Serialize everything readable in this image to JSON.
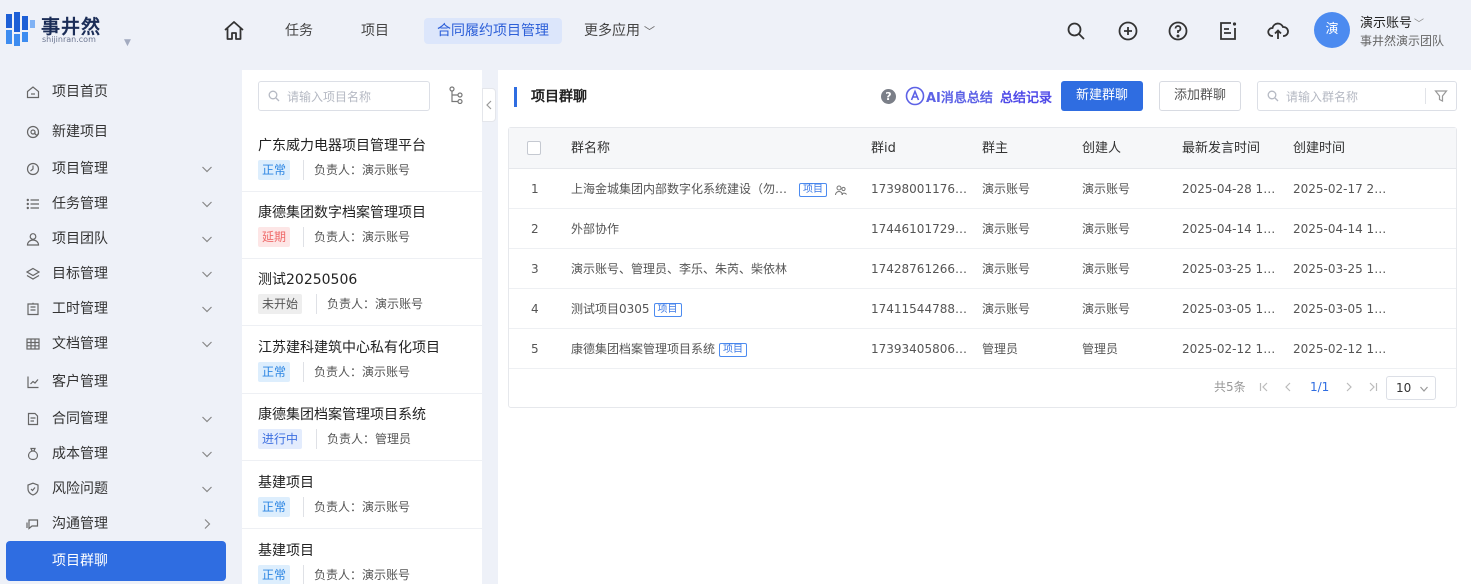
{
  "brand": {
    "name_cn": "事井然",
    "name_en": "shijinran.com"
  },
  "nav": {
    "items": [
      {
        "label": "任务"
      },
      {
        "label": "项目"
      },
      {
        "label": "合同履约项目管理",
        "active": true
      },
      {
        "label": "更多应用"
      }
    ]
  },
  "user": {
    "name": "演示账号",
    "avatar_text": "演",
    "team": "事井然演示团队",
    "caret": "﹀"
  },
  "sidebar": {
    "items": [
      {
        "label": "项目首页",
        "icon": "home-outline-icon",
        "expandable": false
      },
      {
        "label": "新建项目",
        "icon": "at-icon",
        "expandable": false
      },
      {
        "label": "项目管理",
        "icon": "clock-icon",
        "expandable": true
      },
      {
        "label": "任务管理",
        "icon": "list-icon",
        "expandable": true
      },
      {
        "label": "项目团队",
        "icon": "user-icon",
        "expandable": true
      },
      {
        "label": "目标管理",
        "icon": "layers-icon",
        "expandable": true
      },
      {
        "label": "工时管理",
        "icon": "timesheet-icon",
        "expandable": true
      },
      {
        "label": "文档管理",
        "icon": "table-icon",
        "expandable": true
      },
      {
        "label": "客户管理",
        "icon": "customer-icon",
        "expandable": false
      },
      {
        "label": "合同管理",
        "icon": "contract-icon",
        "expandable": true
      },
      {
        "label": "成本管理",
        "icon": "money-bag-icon",
        "expandable": true
      },
      {
        "label": "风险问题",
        "icon": "shield-icon",
        "expandable": true
      },
      {
        "label": "沟通管理",
        "icon": "chat-icon",
        "expandable": true,
        "chevron": "right"
      },
      {
        "label": "项目群聊",
        "active": true
      }
    ]
  },
  "project_list": {
    "search_placeholder": "请输入项目名称",
    "items": [
      {
        "title": "广东威力电器项目管理平台",
        "status": "正常",
        "status_type": "normal",
        "owner": "负责人：演示账号"
      },
      {
        "title": "康德集团数字档案管理项目",
        "status": "延期",
        "status_type": "delay",
        "owner": "负责人：演示账号"
      },
      {
        "title": "测试20250506",
        "status": "未开始",
        "status_type": "notstart",
        "owner": "负责人：演示账号"
      },
      {
        "title": "江苏建科建筑中心私有化项目",
        "status": "正常",
        "status_type": "normal",
        "owner": "负责人：演示账号"
      },
      {
        "title": "康德集团档案管理项目系统",
        "status": "进行中",
        "status_type": "progress",
        "owner": "负责人：管理员"
      },
      {
        "title": "基建项目",
        "status": "正常",
        "status_type": "normal",
        "owner": "负责人：演示账号"
      },
      {
        "title": "基建项目",
        "status": "正常",
        "status_type": "normal",
        "owner": "负责人：演示账号"
      }
    ]
  },
  "main": {
    "title": "项目群聊",
    "help": "?",
    "ai_label": "AI消息总结",
    "summary_link": "总结记录",
    "new_group_button": "新建群聊",
    "add_group_button": "添加群聊",
    "search_placeholder": "请输入群名称"
  },
  "table": {
    "columns": [
      "群名称",
      "群id",
      "群主",
      "创建人",
      "最新发言时间",
      "创建时间"
    ],
    "rows": [
      {
        "index": "1",
        "name": "上海金城集团内部数字化系统建设（勿…",
        "tag": "项目",
        "extra_icon": true,
        "id": "17398001176…",
        "owner": "演示账号",
        "creator": "演示账号",
        "last_msg": "2025-04-28 1…",
        "created": "2025-02-17 2…"
      },
      {
        "index": "2",
        "name": "外部协作",
        "tag": "",
        "extra_icon": false,
        "id": "17446101729…",
        "owner": "演示账号",
        "creator": "演示账号",
        "last_msg": "2025-04-14 1…",
        "created": "2025-04-14 1…"
      },
      {
        "index": "3",
        "name": "演示账号、管理员、李乐、朱芮、柴依林",
        "tag": "",
        "extra_icon": false,
        "id": "17428761266…",
        "owner": "演示账号",
        "creator": "演示账号",
        "last_msg": "2025-03-25 1…",
        "created": "2025-03-25 1…"
      },
      {
        "index": "4",
        "name": "测试项目0305",
        "tag": "项目",
        "extra_icon": false,
        "id": "17411544788…",
        "owner": "演示账号",
        "creator": "演示账号",
        "last_msg": "2025-03-05 1…",
        "created": "2025-03-05 1…"
      },
      {
        "index": "5",
        "name": "康德集团档案管理项目系统",
        "tag": "项目",
        "extra_icon": false,
        "id": "17393405806…",
        "owner": "管理员",
        "creator": "管理员",
        "last_msg": "2025-02-12 1…",
        "created": "2025-02-12 1…"
      }
    ]
  },
  "pagination": {
    "total": "共5条",
    "page": "1/1",
    "page_size": "10"
  },
  "colors": {
    "primary": "#2f6de1",
    "ai": "#5d62e6",
    "bg": "#eef1f8"
  }
}
